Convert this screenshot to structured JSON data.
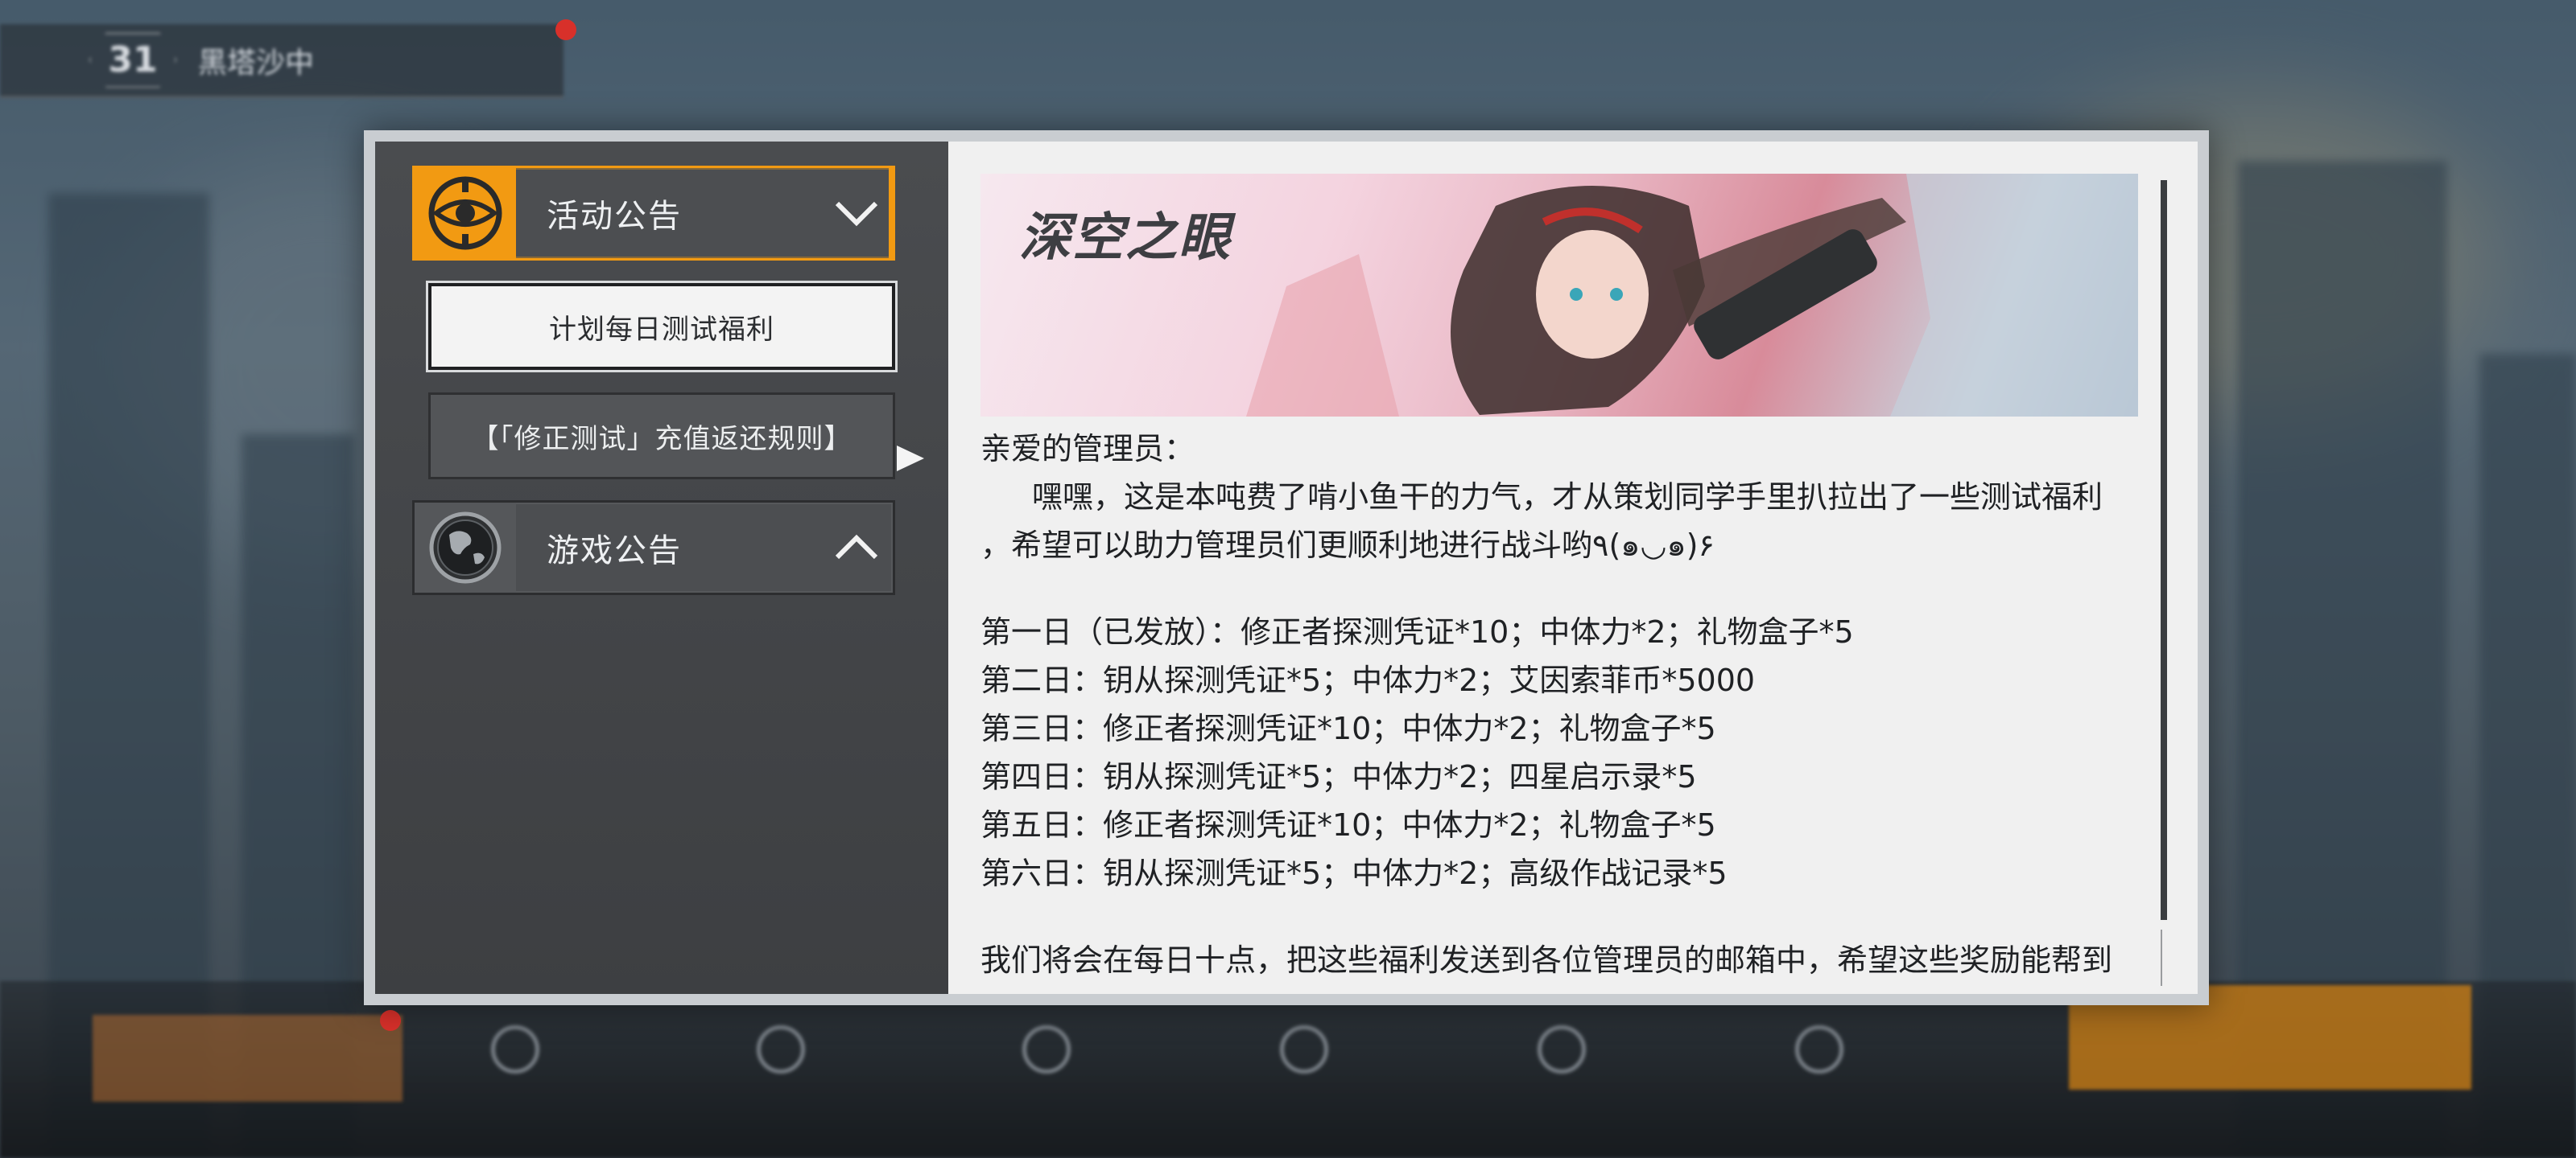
{
  "hud": {
    "level": "31",
    "stage_name": "黑塔沙中"
  },
  "dialog": {
    "categories": [
      {
        "label": "活动公告",
        "icon": "eye-emblem-icon",
        "state": "expanded",
        "chevron": "chevron-down-icon"
      },
      {
        "label": "游戏公告",
        "icon": "globe-icon",
        "state": "collapsed",
        "chevron": "chevron-up-icon"
      }
    ],
    "sub_items": [
      {
        "label": "计划每日测试福利",
        "selected": true
      },
      {
        "label": "【「修正测试」充值返还规则】",
        "selected": false
      }
    ],
    "banner": {
      "logo_text": "深空之眼"
    },
    "article": {
      "greeting": "亲爱的管理员：",
      "intro_line1": "嘿嘿，这是本吨费了啃小鱼干的力气，才从策划同学手里扒拉出了一些测试福利",
      "intro_line2": "，希望可以助力管理员们更顺利地进行战斗哟٩(๑◡๑)۶",
      "rewards": [
        "第一日（已发放）：修正者探测凭证*10；中体力*2；礼物盒子*5",
        "第二日：钥从探测凭证*5；中体力*2；艾因索菲币*5000",
        "第三日：修正者探测凭证*10；中体力*2；礼物盒子*5",
        "第四日：钥从探测凭证*5；中体力*2；四星启示录*5",
        "第五日：修正者探测凭证*10；中体力*2；礼物盒子*5",
        "第六日：钥从探测凭证*5；中体力*2；高级作战记录*5"
      ],
      "closing": "我们将会在每日十点，把这些福利发送到各位管理员的邮箱中，希望这些奖励能帮到"
    }
  },
  "colors": {
    "accent": "#f29a12",
    "panel_bg": "#3e4043",
    "content_bg": "#f0f0f0",
    "frame": "#c9cdd1"
  }
}
